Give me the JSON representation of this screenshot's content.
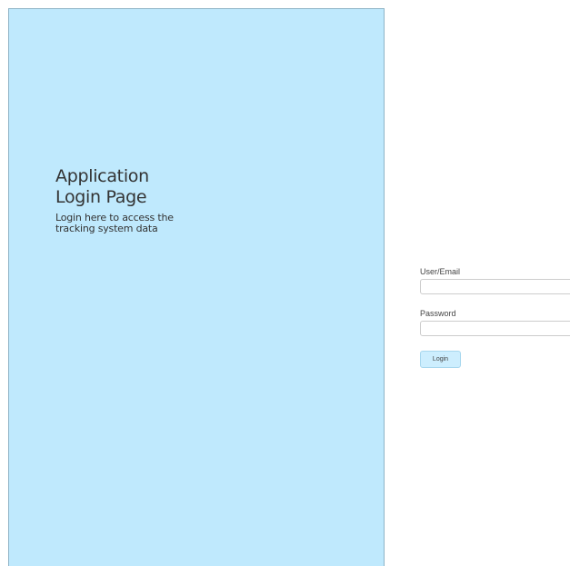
{
  "hero": {
    "title_line1": "Application",
    "title_line2": "Login Page",
    "subtitle": "Login here to access the tracking system data"
  },
  "form": {
    "user_label": "User/Email",
    "user_value": "",
    "password_label": "Password",
    "password_value": "",
    "login_label": "Login"
  },
  "colors": {
    "panel_background": "#bfe9fd",
    "button_background": "#cdeefe"
  }
}
